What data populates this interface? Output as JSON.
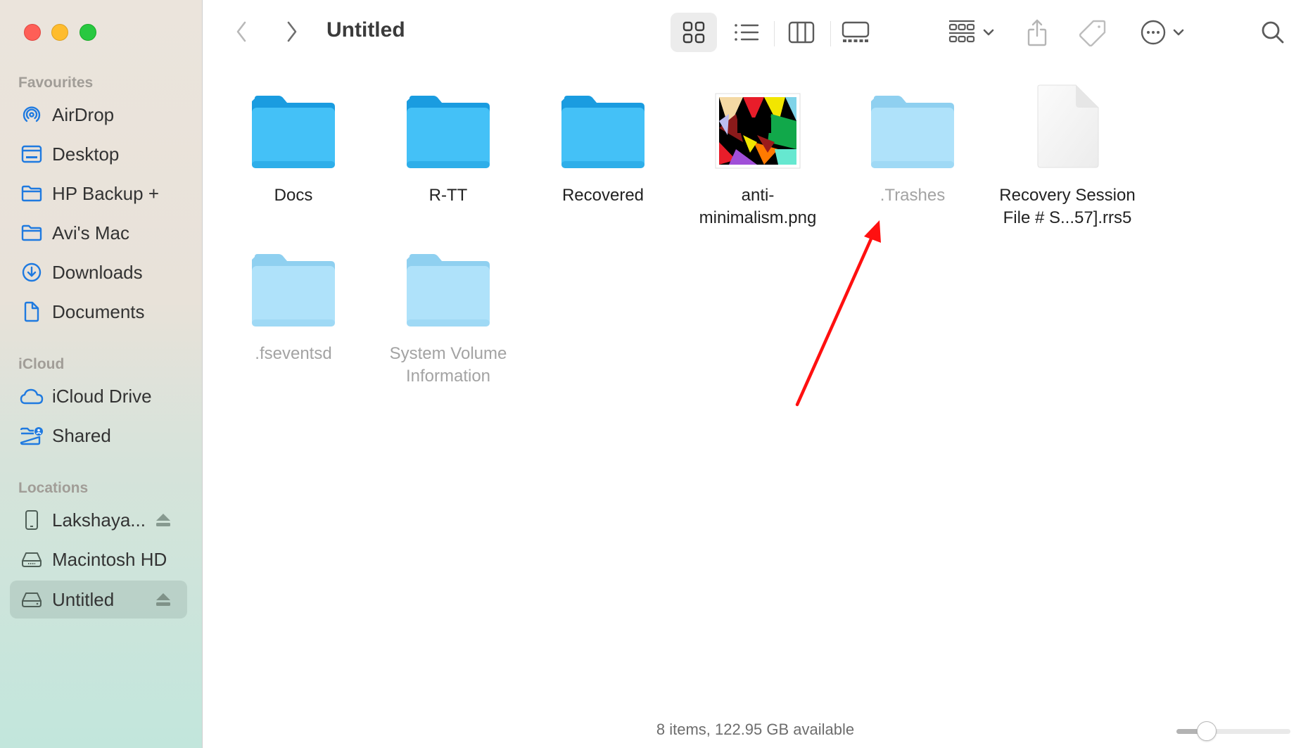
{
  "window": {
    "title": "Untitled",
    "traffic_lights": [
      "close",
      "minimize",
      "zoom"
    ]
  },
  "sidebar": {
    "sections": [
      {
        "label": "Favourites",
        "items": [
          {
            "label": "AirDrop",
            "icon": "airdrop-icon"
          },
          {
            "label": "Desktop",
            "icon": "desktop-icon"
          },
          {
            "label": "HP Backup +",
            "icon": "folder-icon"
          },
          {
            "label": "Avi's Mac",
            "icon": "folder-icon"
          },
          {
            "label": "Downloads",
            "icon": "downloads-icon"
          },
          {
            "label": "Documents",
            "icon": "document-icon"
          }
        ]
      },
      {
        "label": "iCloud",
        "items": [
          {
            "label": "iCloud Drive",
            "icon": "cloud-icon"
          },
          {
            "label": "Shared",
            "icon": "shared-folder-icon"
          }
        ]
      },
      {
        "label": "Locations",
        "items": [
          {
            "label": "Lakshaya...",
            "icon": "iphone-icon",
            "ejectable": true
          },
          {
            "label": "Macintosh HD",
            "icon": "internal-drive-icon"
          },
          {
            "label": "Untitled",
            "icon": "external-drive-icon",
            "ejectable": true,
            "selected": true
          }
        ]
      }
    ]
  },
  "toolbar": {
    "back": "back-chevron-icon",
    "forward": "forward-chevron-icon",
    "views": [
      "icon-view",
      "list-view",
      "column-view",
      "gallery-view"
    ],
    "active_view": "icon-view",
    "group": "group-by-icon",
    "share": "share-icon",
    "tags": "tag-icon",
    "more": "more-actions-icon",
    "search": "search-icon"
  },
  "files": [
    {
      "name": "Docs",
      "kind": "folder",
      "hidden": false
    },
    {
      "name": "R-TT",
      "kind": "folder",
      "hidden": false
    },
    {
      "name": "Recovered",
      "kind": "folder",
      "hidden": false
    },
    {
      "name": "anti-\nminimalism.png",
      "kind": "image",
      "hidden": false
    },
    {
      "name": ".Trashes",
      "kind": "folder",
      "hidden": true
    },
    {
      "name": "Recovery Session\nFile # S...57].rrs5",
      "kind": "document",
      "hidden": false
    },
    {
      "name": ".fseventsd",
      "kind": "folder",
      "hidden": true
    },
    {
      "name": "System Volume\nInformation",
      "kind": "folder",
      "hidden": true
    }
  ],
  "status": {
    "text": "8 items, 122.95 GB available"
  },
  "icon_size_slider": {
    "value_fraction": 0.22
  },
  "annotation": {
    "type": "red-arrow",
    "points_to": ".Trashes",
    "color": "#ff0000"
  },
  "colors": {
    "folder_blue": "#3fb9f5",
    "folder_tab": "#1f9fe0",
    "hidden_folder": "#aee0f9",
    "sidebar_icon_blue": "#1f7ae0"
  }
}
